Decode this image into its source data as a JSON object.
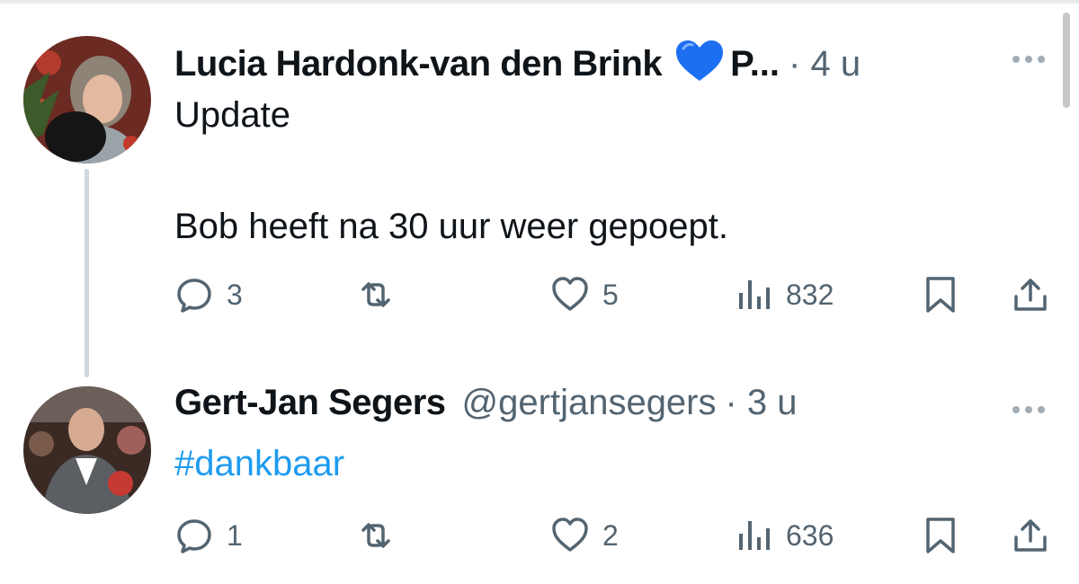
{
  "tweets": [
    {
      "author": "Lucia Hardonk-van den Brink",
      "truncated_suffix": "P...",
      "separator_time": "· 4 u",
      "text_line1": "Update",
      "text_line2": "Bob heeft na 30 uur weer gepoept.",
      "replies": "3",
      "likes": "5",
      "views": "832",
      "badge_icon": "blue-heart-emoji"
    },
    {
      "author": "Gert-Jan Segers",
      "handle": "@gertjansegers",
      "separator_time": "· 3 u",
      "hashtag": "#dankbaar",
      "replies": "1",
      "likes": "2",
      "views": "636"
    }
  ],
  "colors": {
    "text": "#0f1419",
    "muted": "#536471",
    "link": "#1d9bf0",
    "badge_heart": "#1d6ff2",
    "thread_line": "#cfd9de"
  }
}
